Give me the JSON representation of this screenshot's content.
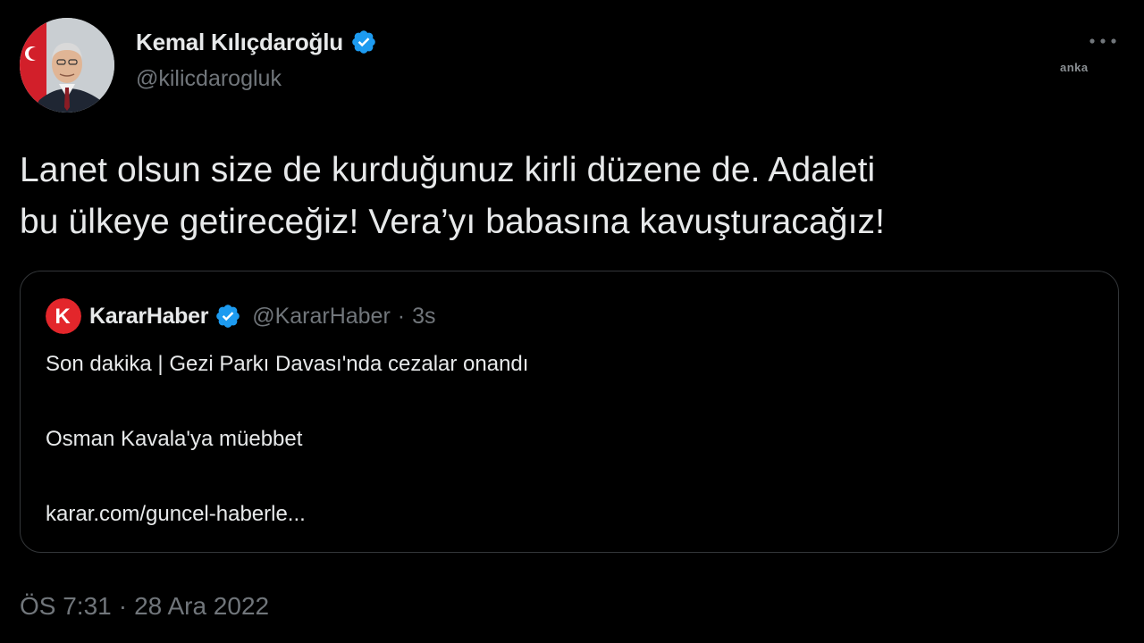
{
  "tweet": {
    "author": {
      "display_name": "Kemal Kılıçdaroğlu",
      "handle": "@kilicdarogluk",
      "verified_icon": "verified-badge-icon"
    },
    "text_lines": [
      "Lanet olsun size de kurduğunuz kirli düzene de. Adaleti",
      "bu ülkeye getireceğiz! Vera’yı babasına kavuşturacağız!"
    ],
    "quoted": {
      "logo_letter": "K",
      "name": "KararHaber",
      "handle": "@KararHaber",
      "separator": "·",
      "time": "3s",
      "lines": [
        "Son dakika | Gezi Parkı Davası'nda cezalar onandı",
        "Osman Kavala'ya müebbet",
        "karar.com/guncel-haberle..."
      ]
    },
    "timestamp": {
      "time": "ÖS 7:31",
      "separator": "·",
      "date": "28 Ara 2022"
    }
  },
  "watermark": "anka",
  "colors": {
    "background": "#000000",
    "text": "#e7e9ea",
    "secondary": "#71767b",
    "verified": "#1d9bf0",
    "border": "#333639",
    "karar_red": "#e3262b"
  }
}
